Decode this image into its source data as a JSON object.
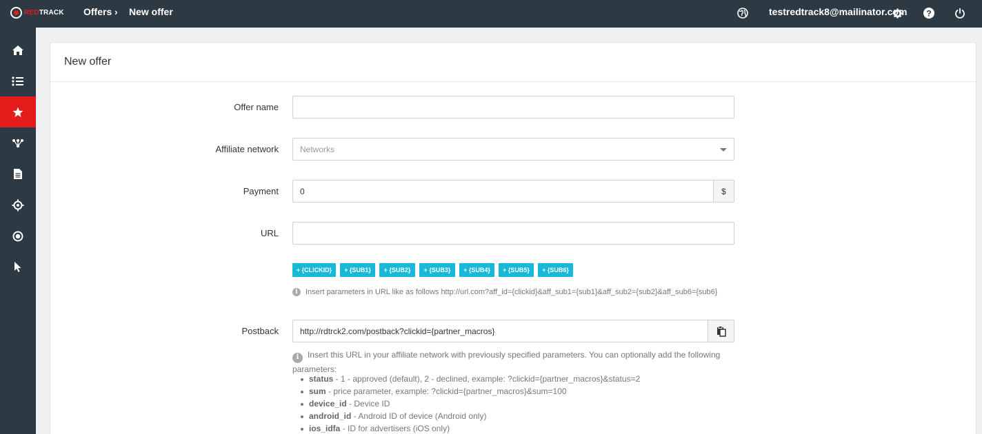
{
  "topbar": {
    "logo_red": "RED",
    "logo_white": "TRACK",
    "breadcrumb": [
      "Offers",
      "New offer"
    ],
    "breadcrumb_sep": "›",
    "user_email": "testredtrack8@mailinator.com",
    "icons": [
      "globe-icon",
      "gear-icon",
      "help-icon",
      "power-icon"
    ]
  },
  "sidebar": {
    "items": [
      {
        "name": "home",
        "icon": "home-icon",
        "active": false
      },
      {
        "name": "campaigns",
        "icon": "list-icon",
        "active": false
      },
      {
        "name": "offers",
        "icon": "star-icon",
        "active": true
      },
      {
        "name": "networks",
        "icon": "network-icon",
        "active": false
      },
      {
        "name": "reports",
        "icon": "document-icon",
        "active": false
      },
      {
        "name": "tracking",
        "icon": "crosshair-icon",
        "active": false
      },
      {
        "name": "conversions",
        "icon": "target-icon",
        "active": false
      },
      {
        "name": "clicks",
        "icon": "cursor-icon",
        "active": false
      }
    ],
    "active_color": "#e31b1b"
  },
  "panel": {
    "title": "New offer"
  },
  "form": {
    "offer_name": {
      "label": "Offer name",
      "value": ""
    },
    "affiliate_network": {
      "label": "Affiliate network",
      "placeholder": "Networks"
    },
    "payment": {
      "label": "Payment",
      "value": "0",
      "currency": "$"
    },
    "url": {
      "label": "URL",
      "value": ""
    },
    "macros": [
      "+ {CLICKID}",
      "+ {SUB1}",
      "+ {SUB2}",
      "+ {SUB3}",
      "+ {SUB4}",
      "+ {SUB5}",
      "+ {SUB6}"
    ],
    "url_hint": "Insert parameters in URL like as follows http://url.com?aff_id={clickid}&aff_sub1={sub1}&aff_sub2={sub2}&aff_sub6={sub6}",
    "postback": {
      "label": "Postback",
      "value": "http://rdtrck2.com/postback?clickid={partner_macros}",
      "note": "Insert this URL in your affiliate network with previously specified parameters. You can optionally add the following parameters:",
      "params": [
        {
          "key": "status",
          "desc": " - 1 - approved (default), 2 - declined, example: ?clickid={partner_macros}&status=2"
        },
        {
          "key": "sum",
          "desc": " - price parameter, example: ?clickid={partner_macros}&sum=100"
        },
        {
          "key": "device_id",
          "desc": " - Device ID"
        },
        {
          "key": "android_id",
          "desc": " - Android ID of device (Android only)"
        },
        {
          "key": "ios_idfa",
          "desc": " - ID for advertisers (iOS only)"
        }
      ]
    }
  },
  "colors": {
    "topbar": "#2d3a44",
    "accent_red": "#e31b1b",
    "macro_button": "#17b8d8"
  }
}
